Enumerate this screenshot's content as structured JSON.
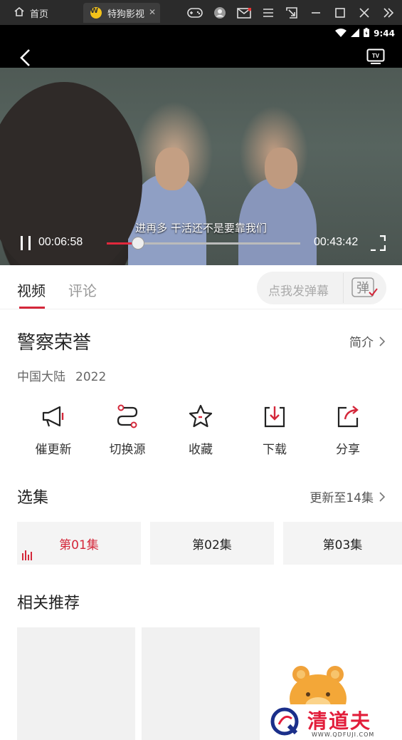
{
  "emulator": {
    "home_tab": "首页",
    "app_tab": "特狗影视",
    "app_badge": "W"
  },
  "status_bar": {
    "time": "9:44"
  },
  "player": {
    "subtitle": "进再多 干活还不是要靠我们",
    "current_time": "00:06:58",
    "total_time": "00:43:42",
    "progress": 0.16
  },
  "tabs": {
    "video": "视频",
    "comments": "评论"
  },
  "danmaku": {
    "placeholder": "点我发弹幕",
    "button": "弹"
  },
  "show": {
    "title": "警察荣誉",
    "intro_link": "简介",
    "region": "中国大陆",
    "year": "2022"
  },
  "actions": [
    {
      "label": "催更新",
      "icon": "megaphone-icon"
    },
    {
      "label": "切换源",
      "icon": "switch-source-icon"
    },
    {
      "label": "收藏",
      "icon": "star-icon"
    },
    {
      "label": "下载",
      "icon": "download-icon"
    },
    {
      "label": "分享",
      "icon": "share-icon"
    }
  ],
  "episodes": {
    "title": "选集",
    "update_status": "更新至14集",
    "items": [
      "第01集",
      "第02集",
      "第03集"
    ]
  },
  "recommendations": {
    "title": "相关推荐"
  },
  "watermark": {
    "text": "清道夫",
    "url": "WWW.QDFUJI.COM"
  },
  "colors": {
    "accent": "#d4273a",
    "player_bg": "#000000"
  }
}
